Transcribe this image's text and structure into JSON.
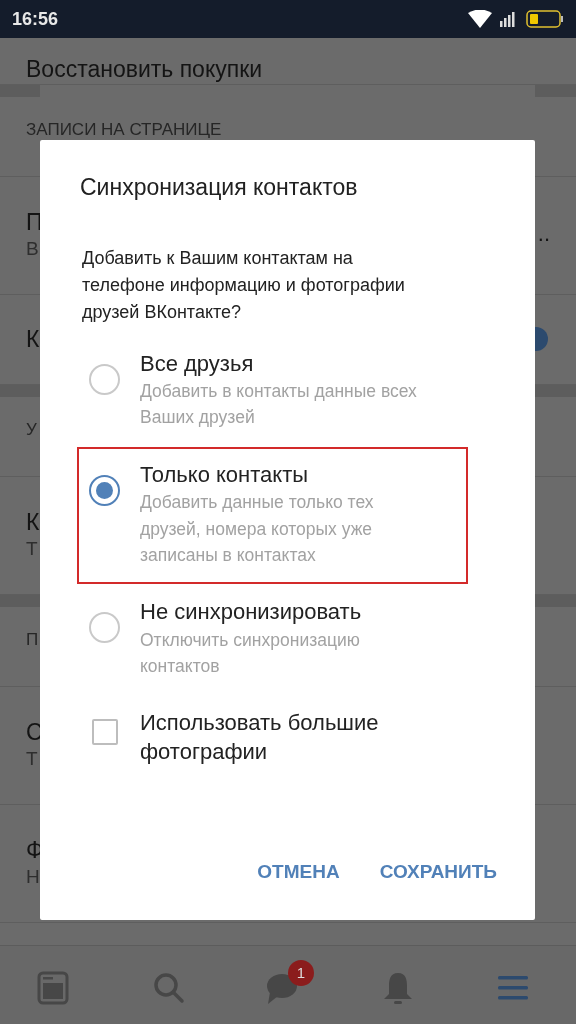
{
  "status_bar": {
    "time": "16:56"
  },
  "settings": [
    {
      "kind": "item",
      "title": "Восстановить покупки"
    },
    {
      "kind": "gap"
    },
    {
      "kind": "header",
      "title": "ЗАПИСИ НА СТРАНИЦЕ"
    },
    {
      "kind": "item",
      "title": "П",
      "subtitle": "В",
      "trailing": ".."
    },
    {
      "kind": "item",
      "title": "К",
      "toggle": {
        "on": true
      }
    },
    {
      "kind": "gap"
    },
    {
      "kind": "header",
      "title": "У"
    },
    {
      "kind": "item",
      "title": "К",
      "subtitle": "Т"
    },
    {
      "kind": "gap"
    },
    {
      "kind": "header",
      "title": "П"
    },
    {
      "kind": "item",
      "title": "С",
      "subtitle": "Т"
    },
    {
      "kind": "item",
      "title": "Ф",
      "subtitle": "Н"
    }
  ],
  "dialog": {
    "title": "Синхронизация контактов",
    "message": "Добавить к Вашим контактам на телефоне информацию и фотографии друзей ВКонтакте?",
    "options": [
      {
        "kind": "radio",
        "label": "Все друзья",
        "description": "Добавить в контакты данные всех Ваших друзей",
        "selected": false,
        "highlighted": false
      },
      {
        "kind": "radio",
        "label": "Только контакты",
        "description": "Добавить данные только тех друзей, номера которых уже записаны в контактах",
        "selected": true,
        "highlighted": true
      },
      {
        "kind": "radio",
        "label": "Не синхронизировать",
        "description": "Отключить синхронизацию контактов",
        "selected": false,
        "highlighted": false
      },
      {
        "kind": "checkbox",
        "label": "Использовать большие фотографии",
        "checked": false
      }
    ],
    "buttons": [
      "ОТМЕНА",
      "СОХРАНИТЬ"
    ]
  },
  "bottom_nav": [
    {
      "kind": "news",
      "selected": false
    },
    {
      "kind": "search",
      "selected": false
    },
    {
      "kind": "messages",
      "selected": false,
      "badge": "1"
    },
    {
      "kind": "notifications",
      "selected": false
    },
    {
      "kind": "menu",
      "selected": true
    }
  ]
}
